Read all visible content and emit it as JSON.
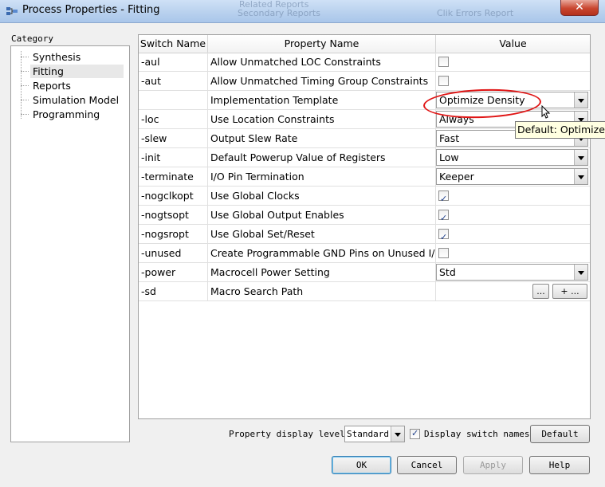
{
  "window": {
    "title": "Process Properties - Fitting",
    "close_label": "✕",
    "bg_ghost_1": "Related Reports",
    "bg_ghost_2": "Secondary Reports",
    "bg_ghost_3": "Clik Errors Report"
  },
  "category": {
    "label": "Category",
    "items": [
      {
        "label": "Synthesis",
        "selected": false
      },
      {
        "label": "Fitting",
        "selected": true
      },
      {
        "label": "Reports",
        "selected": false
      },
      {
        "label": "Simulation Model",
        "selected": false
      },
      {
        "label": "Programming",
        "selected": false
      }
    ]
  },
  "grid": {
    "headers": {
      "switch": "Switch Name",
      "property": "Property Name",
      "value": "Value"
    },
    "rows": [
      {
        "switch": "-aul",
        "property": "Allow Unmatched LOC Constraints",
        "kind": "checkbox",
        "checked": false
      },
      {
        "switch": "-aut",
        "property": "Allow Unmatched Timing Group Constraints",
        "kind": "checkbox",
        "checked": false
      },
      {
        "switch": "",
        "property": "Implementation Template",
        "kind": "combo",
        "value": "Optimize Density"
      },
      {
        "switch": "-loc",
        "property": "Use Location Constraints",
        "kind": "combo",
        "value": "Always"
      },
      {
        "switch": "-slew",
        "property": "Output Slew Rate",
        "kind": "combo",
        "value": "Fast"
      },
      {
        "switch": "-init",
        "property": "Default Powerup Value of Registers",
        "kind": "combo",
        "value": "Low"
      },
      {
        "switch": "-terminate",
        "property": "I/O Pin Termination",
        "kind": "combo",
        "value": "Keeper"
      },
      {
        "switch": "-nogclkopt",
        "property": "Use Global Clocks",
        "kind": "checkbox",
        "checked": true
      },
      {
        "switch": "-nogtsopt",
        "property": "Use Global Output Enables",
        "kind": "checkbox",
        "checked": true
      },
      {
        "switch": "-nogsropt",
        "property": "Use Global Set/Reset",
        "kind": "checkbox",
        "checked": true
      },
      {
        "switch": "-unused",
        "property": "Create Programmable GND Pins on Unused I/O",
        "kind": "checkbox",
        "checked": false
      },
      {
        "switch": "-power",
        "property": "Macrocell Power Setting",
        "kind": "combo",
        "value": "Std"
      },
      {
        "switch": "-sd",
        "property": "Macro Search Path",
        "kind": "path",
        "browse_label": "...",
        "add_label": "+ ..."
      }
    ],
    "check_glyph": "✓"
  },
  "tooltip": {
    "text": "Default: Optimize B"
  },
  "footer": {
    "display_level_label": "Property display level:",
    "display_level_value": "Standard",
    "display_switch_label": "Display switch names",
    "display_switch_checked": true,
    "default_button": "Default",
    "ok_button": "OK",
    "cancel_button": "Cancel",
    "apply_button": "Apply",
    "help_button": "Help"
  },
  "colors": {
    "annotation_red": "#e01515",
    "tooltip_bg": "#ffffe1",
    "title_gradient_top": "#cfe1f6"
  }
}
